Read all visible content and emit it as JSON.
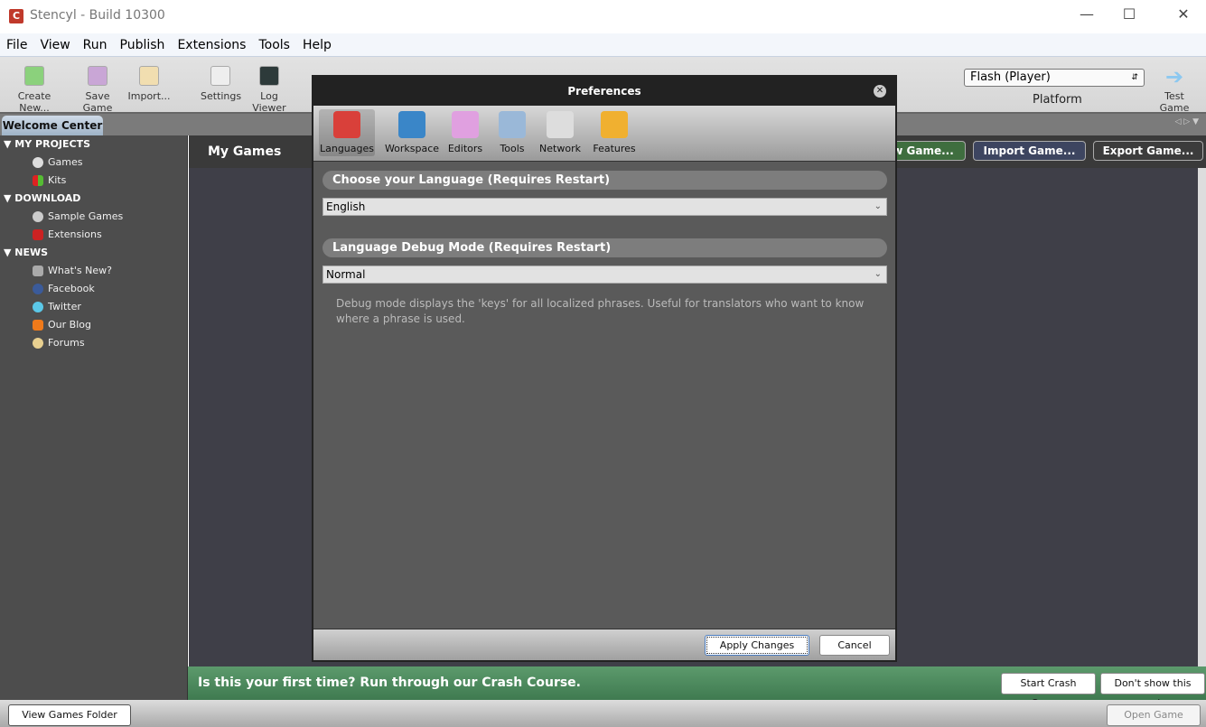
{
  "window": {
    "title": "Stencyl - Build 10300",
    "logo": "C"
  },
  "menu": [
    "File",
    "View",
    "Run",
    "Publish",
    "Extensions",
    "Tools",
    "Help"
  ],
  "toolbar": {
    "items": [
      {
        "label": "Create New...",
        "icon": "create-new-icon",
        "color": "#8bd17c"
      },
      {
        "label": "Save Game",
        "icon": "save-icon",
        "color": "#c9a6d6"
      },
      {
        "label": "Import...",
        "icon": "import-icon",
        "color": "#f1deb0"
      },
      {
        "label": "Settings",
        "icon": "settings-icon",
        "color": "#eeeeee"
      },
      {
        "label": "Log Viewer",
        "icon": "log-viewer-icon",
        "color": "#2d3a3a"
      }
    ],
    "platform_value": "Flash (Player)",
    "platform_label": "Platform",
    "test_game": "Test Game"
  },
  "tabs": {
    "active": "Welcome Center"
  },
  "sidebar": {
    "sections": [
      {
        "title": "MY PROJECTS",
        "items": [
          {
            "label": "Games",
            "color": "#dddddd"
          },
          {
            "label": "Kits",
            "color": "#3a8de0"
          }
        ]
      },
      {
        "title": "DOWNLOAD",
        "items": [
          {
            "label": "Sample Games",
            "color": "#cccccc"
          },
          {
            "label": "Extensions",
            "color": "#cc2a2a"
          }
        ]
      },
      {
        "title": "NEWS",
        "items": [
          {
            "label": "What's New?",
            "color": "#aaaaaa"
          },
          {
            "label": "Facebook",
            "color": "#3b5b9a"
          },
          {
            "label": "Twitter",
            "color": "#5bc8e8"
          },
          {
            "label": "Our Blog",
            "color": "#f07a1a"
          },
          {
            "label": "Forums",
            "color": "#e8d090"
          }
        ]
      }
    ]
  },
  "main": {
    "title": "My Games",
    "buttons": [
      {
        "label": "w Game...",
        "color": "#3f6e3f"
      },
      {
        "label": "Import Game...",
        "color": "#3d4560"
      },
      {
        "label": "Export Game...",
        "color": "#3c3c3c"
      }
    ]
  },
  "dialog": {
    "title": "Preferences",
    "tabs": [
      {
        "label": "Languages",
        "color": "#d9403a"
      },
      {
        "label": "Workspace",
        "color": "#3a86c8"
      },
      {
        "label": "Editors",
        "color": "#e0a0e0"
      },
      {
        "label": "Tools",
        "color": "#9ab8d8"
      },
      {
        "label": "Network",
        "color": "#dddddd"
      },
      {
        "label": "Features",
        "color": "#f0b030"
      }
    ],
    "language_header": "Choose your Language (Requires Restart)",
    "language_value": "English",
    "debug_header": "Language Debug Mode (Requires Restart)",
    "debug_value": "Normal",
    "note": "Debug mode displays the 'keys' for all localized phrases. Useful for translators who want to know where a phrase is used.",
    "apply": "Apply Changes",
    "cancel": "Cancel"
  },
  "crash_course": {
    "message": "Is this your first time? Run through our Crash Course.",
    "start": "Start Crash Course",
    "dismiss": "Don't show this again"
  },
  "bottom": {
    "view_folder": "View Games Folder",
    "open_game": "Open Game"
  }
}
